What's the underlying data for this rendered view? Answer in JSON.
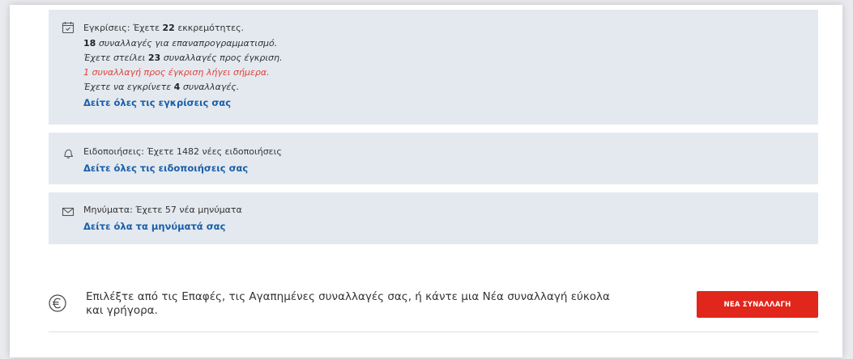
{
  "approvals": {
    "title_prefix": "Εγκρίσεις: Έχετε",
    "pending_count": "22",
    "title_suffix": "εκκρεμότητες.",
    "reschedule_count": "18",
    "reschedule_text": "συναλλαγές για επαναπρογραμματισμό.",
    "sent_prefix": "Έχετε στείλει",
    "sent_count": "23",
    "sent_suffix": "συναλλαγές προς έγκριση.",
    "expiring_text": "1 συναλλαγή προς έγκριση λήγει σήμερα.",
    "to_approve_prefix": "Έχετε να εγκρίνετε",
    "to_approve_count": "4",
    "to_approve_suffix": "συναλλαγές.",
    "link": "Δείτε όλες τις εγκρίσεις σας",
    "icon": "calendar-check-icon"
  },
  "notifications": {
    "text": "Ειδοποιήσεις: Έχετε 1482 νέες ειδοποιήσεις",
    "link": "Δείτε όλες τις ειδοποιήσεις σας",
    "icon": "bell-icon"
  },
  "messages": {
    "text": "Μηνύματα: Έχετε 57 νέα μηνύματα",
    "link": "Δείτε όλα τα μηνύματά σας",
    "icon": "envelope-icon"
  },
  "new_transaction": {
    "text": "Επιλέξτε από τις Επαφές, τις Αγαπημένες συναλλαγές σας, ή κάντε μια Νέα συναλλαγή εύκολα και γρήγορα.",
    "button": "ΝΕΑ ΣΥΝΑΛΛΑΓΗ",
    "icon": "euro-icon"
  },
  "colors": {
    "accent": "#e1261c",
    "link": "#1a5ea8",
    "panel": "#e3e9ef",
    "alert": "#e0413b"
  }
}
